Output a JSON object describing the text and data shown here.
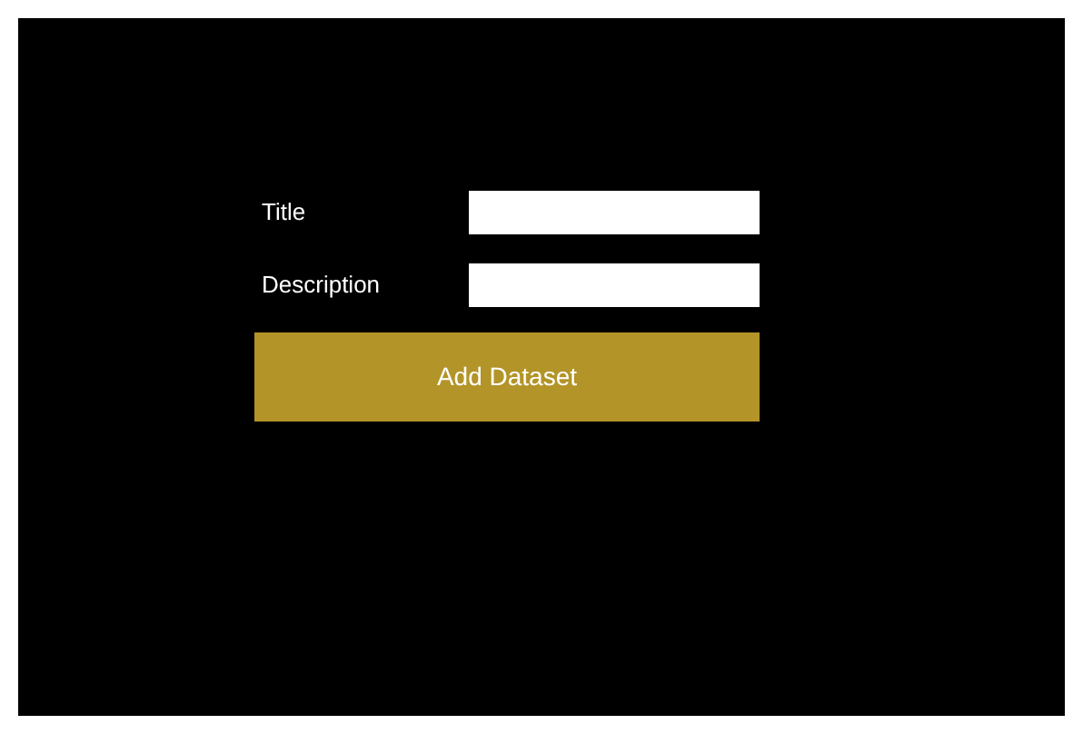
{
  "form": {
    "fields": [
      {
        "label": "Title"
      },
      {
        "label": "Description"
      }
    ],
    "button": "Add Dataset"
  }
}
